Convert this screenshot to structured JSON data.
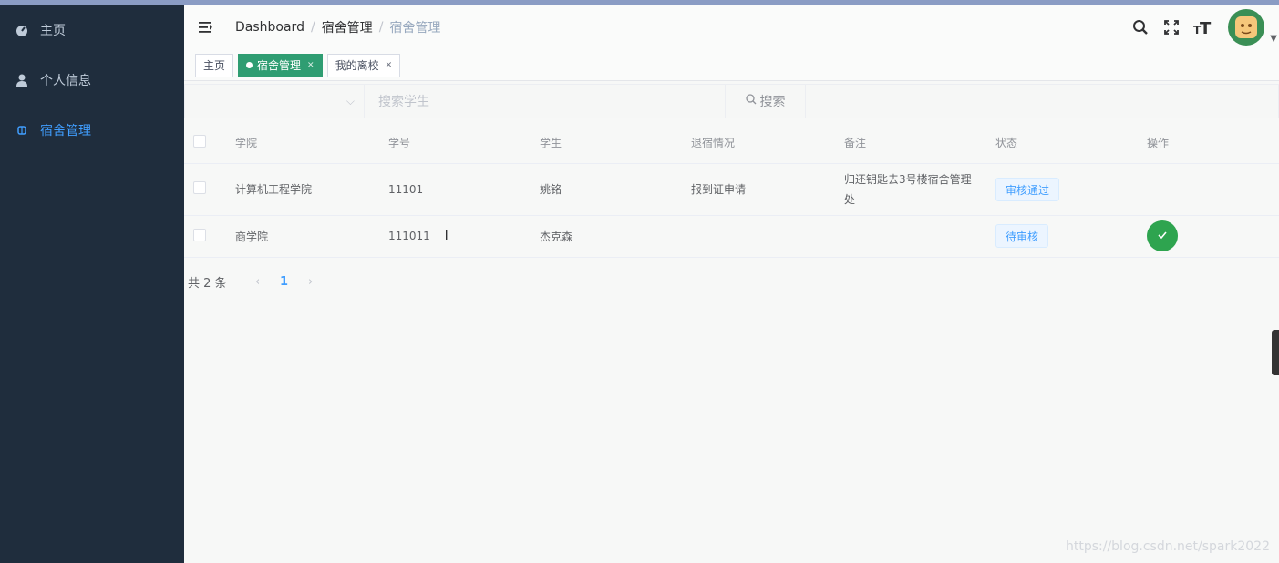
{
  "sidebar": {
    "items": [
      {
        "label": "主页",
        "icon": "dashboard-icon"
      },
      {
        "label": "个人信息",
        "icon": "user-icon"
      },
      {
        "label": "宿舍管理",
        "icon": "dorm-icon"
      }
    ]
  },
  "navbar": {
    "breadcrumb": [
      "Dashboard",
      "宿舍管理",
      "宿舍管理"
    ]
  },
  "tags": [
    {
      "label": "主页",
      "active": false
    },
    {
      "label": "宿舍管理",
      "active": true
    },
    {
      "label": "我的离校",
      "active": false
    }
  ],
  "filter": {
    "search_placeholder": "搜索学生",
    "search_button": "搜索"
  },
  "table": {
    "columns": [
      "学院",
      "学号",
      "学生",
      "退宿情况",
      "备注",
      "状态",
      "操作"
    ],
    "rows": [
      {
        "college": "计算机工程学院",
        "id": "11101",
        "student": "姚铭",
        "checkout": "报到证申请",
        "note": "归还钥匙去3号楼宿舍管理处",
        "status": "审核通过"
      },
      {
        "college": "商学院",
        "id": "111011",
        "student": "杰克森",
        "checkout": "",
        "note": "",
        "status": "待审核"
      }
    ]
  },
  "pager": {
    "total": "共 2 条",
    "current": "1"
  },
  "watermark": "https://blog.csdn.net/spark2022"
}
